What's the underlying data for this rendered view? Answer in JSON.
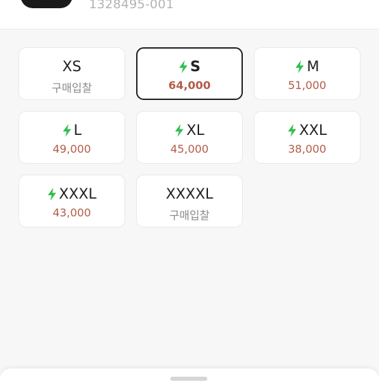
{
  "product": {
    "style_code": "1328495-001",
    "thumbnail_icon": "black-garment-thumbnail"
  },
  "colors": {
    "price": "#b45c4a",
    "bid_text": "#8a8a8a",
    "bolt": "#2fbf4f",
    "selected_border": "#222222"
  },
  "sizes": [
    {
      "label": "XS",
      "price": "구매입찰",
      "fast": false,
      "selected": false,
      "is_bid": true
    },
    {
      "label": "S",
      "price": "64,000",
      "fast": true,
      "selected": true,
      "is_bid": false
    },
    {
      "label": "M",
      "price": "51,000",
      "fast": true,
      "selected": false,
      "is_bid": false
    },
    {
      "label": "L",
      "price": "49,000",
      "fast": true,
      "selected": false,
      "is_bid": false
    },
    {
      "label": "XL",
      "price": "45,000",
      "fast": true,
      "selected": false,
      "is_bid": false
    },
    {
      "label": "XXL",
      "price": "38,000",
      "fast": true,
      "selected": false,
      "is_bid": false
    },
    {
      "label": "XXXL",
      "price": "43,000",
      "fast": true,
      "selected": false,
      "is_bid": false
    },
    {
      "label": "XXXXL",
      "price": "구매입찰",
      "fast": false,
      "selected": false,
      "is_bid": true
    }
  ],
  "icons": {
    "fast_delivery": "lightning-bolt-icon",
    "sheet_handle": "drag-handle"
  }
}
